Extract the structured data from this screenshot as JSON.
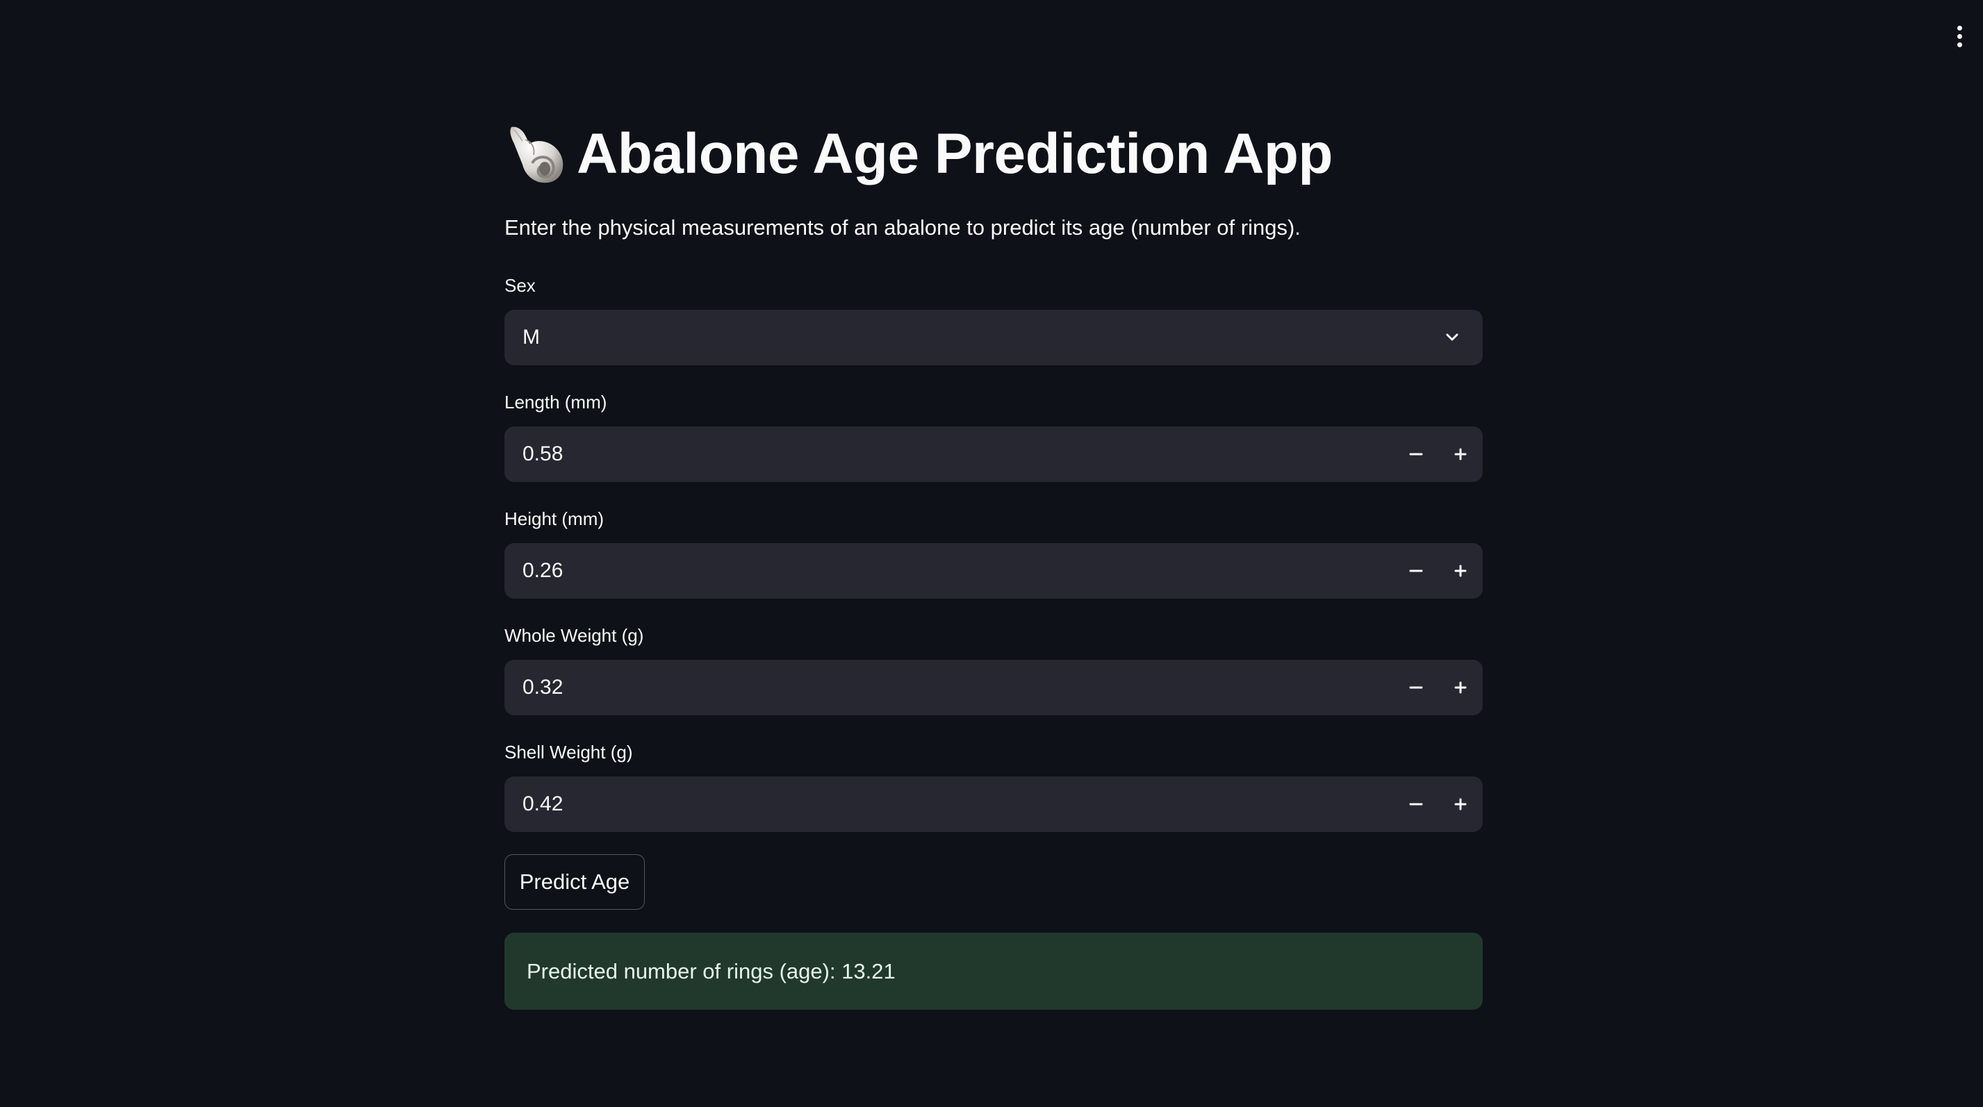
{
  "header": {
    "menu_icon": "kebab-menu-icon"
  },
  "main": {
    "title_icon": "spiral-shell-emoji-icon",
    "title": "Abalone Age Prediction App",
    "subtitle": "Enter the physical measurements of an abalone to predict its age (number of rings)."
  },
  "form": {
    "sex": {
      "label": "Sex",
      "value": "M"
    },
    "length": {
      "label": "Length (mm)",
      "value": "0.58"
    },
    "height": {
      "label": "Height (mm)",
      "value": "0.26"
    },
    "whole_weight": {
      "label": "Whole Weight (g)",
      "value": "0.32"
    },
    "shell_weight": {
      "label": "Shell Weight (g)",
      "value": "0.42"
    },
    "submit_label": "Predict Age"
  },
  "result": {
    "text": "Predicted number of rings (age): 13.21"
  },
  "colors": {
    "background": "#0e1117",
    "input_background": "#262730",
    "success_background": "#21392c",
    "text": "#fafafa"
  }
}
